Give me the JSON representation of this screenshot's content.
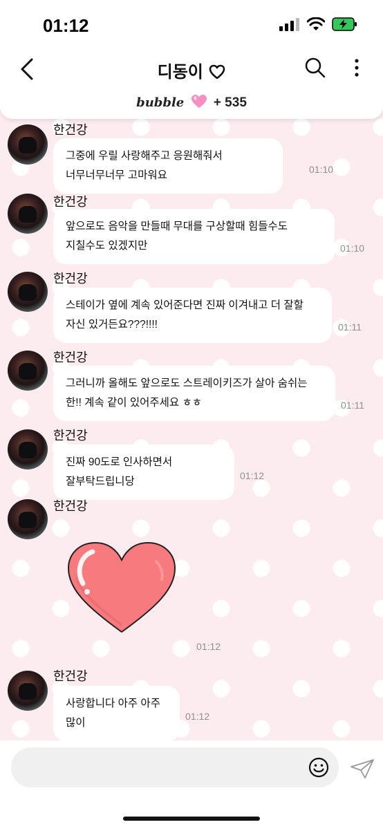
{
  "status": {
    "time": "01:12"
  },
  "header": {
    "title": "디동이",
    "logo": "bubble",
    "count": "+ 535",
    "icons": [
      "back-icon",
      "heart-outline-icon",
      "search-icon",
      "more-vertical-icon",
      "pink-heart-icon"
    ]
  },
  "messages": [
    {
      "sender": "한건강",
      "text": "그중에 우릴 사랑해주고 응원해줘서 너무너무너무 고마워요",
      "time": "01:10"
    },
    {
      "sender": "한건강",
      "text": "앞으로도 음악을 만들때 무대를 구상할때 힘들수도 지칠수도 있겠지만",
      "time": "01:10"
    },
    {
      "sender": "한건강",
      "text": "스테이가 옆에 계속 있어준다면 진짜 이겨내고 더 잘할 자신 있거든요???!!!!",
      "time": "01:11"
    },
    {
      "sender": "한건강",
      "text": "그러니까 올해도 앞으로도 스트레이키즈가 살아 숨쉬는 한!! 계속 같이 있어주세요 ㅎㅎ",
      "time": "01:11"
    },
    {
      "sender": "한건강",
      "text": "진짜 90도로 인사하면서 잘부탁드립니당",
      "time": "01:12"
    },
    {
      "sender": "한건강",
      "sticker": "heart-sticker",
      "time": "01:12"
    },
    {
      "sender": "한건강",
      "text": "사랑합니다 아주 아주 많이",
      "time": "01:12"
    }
  ],
  "input": {
    "value": "",
    "placeholder": ""
  },
  "colors": {
    "background": "#fcebef",
    "bubble": "#ffffff",
    "heart": "#f77a7e",
    "time": "#8f8f8f"
  }
}
